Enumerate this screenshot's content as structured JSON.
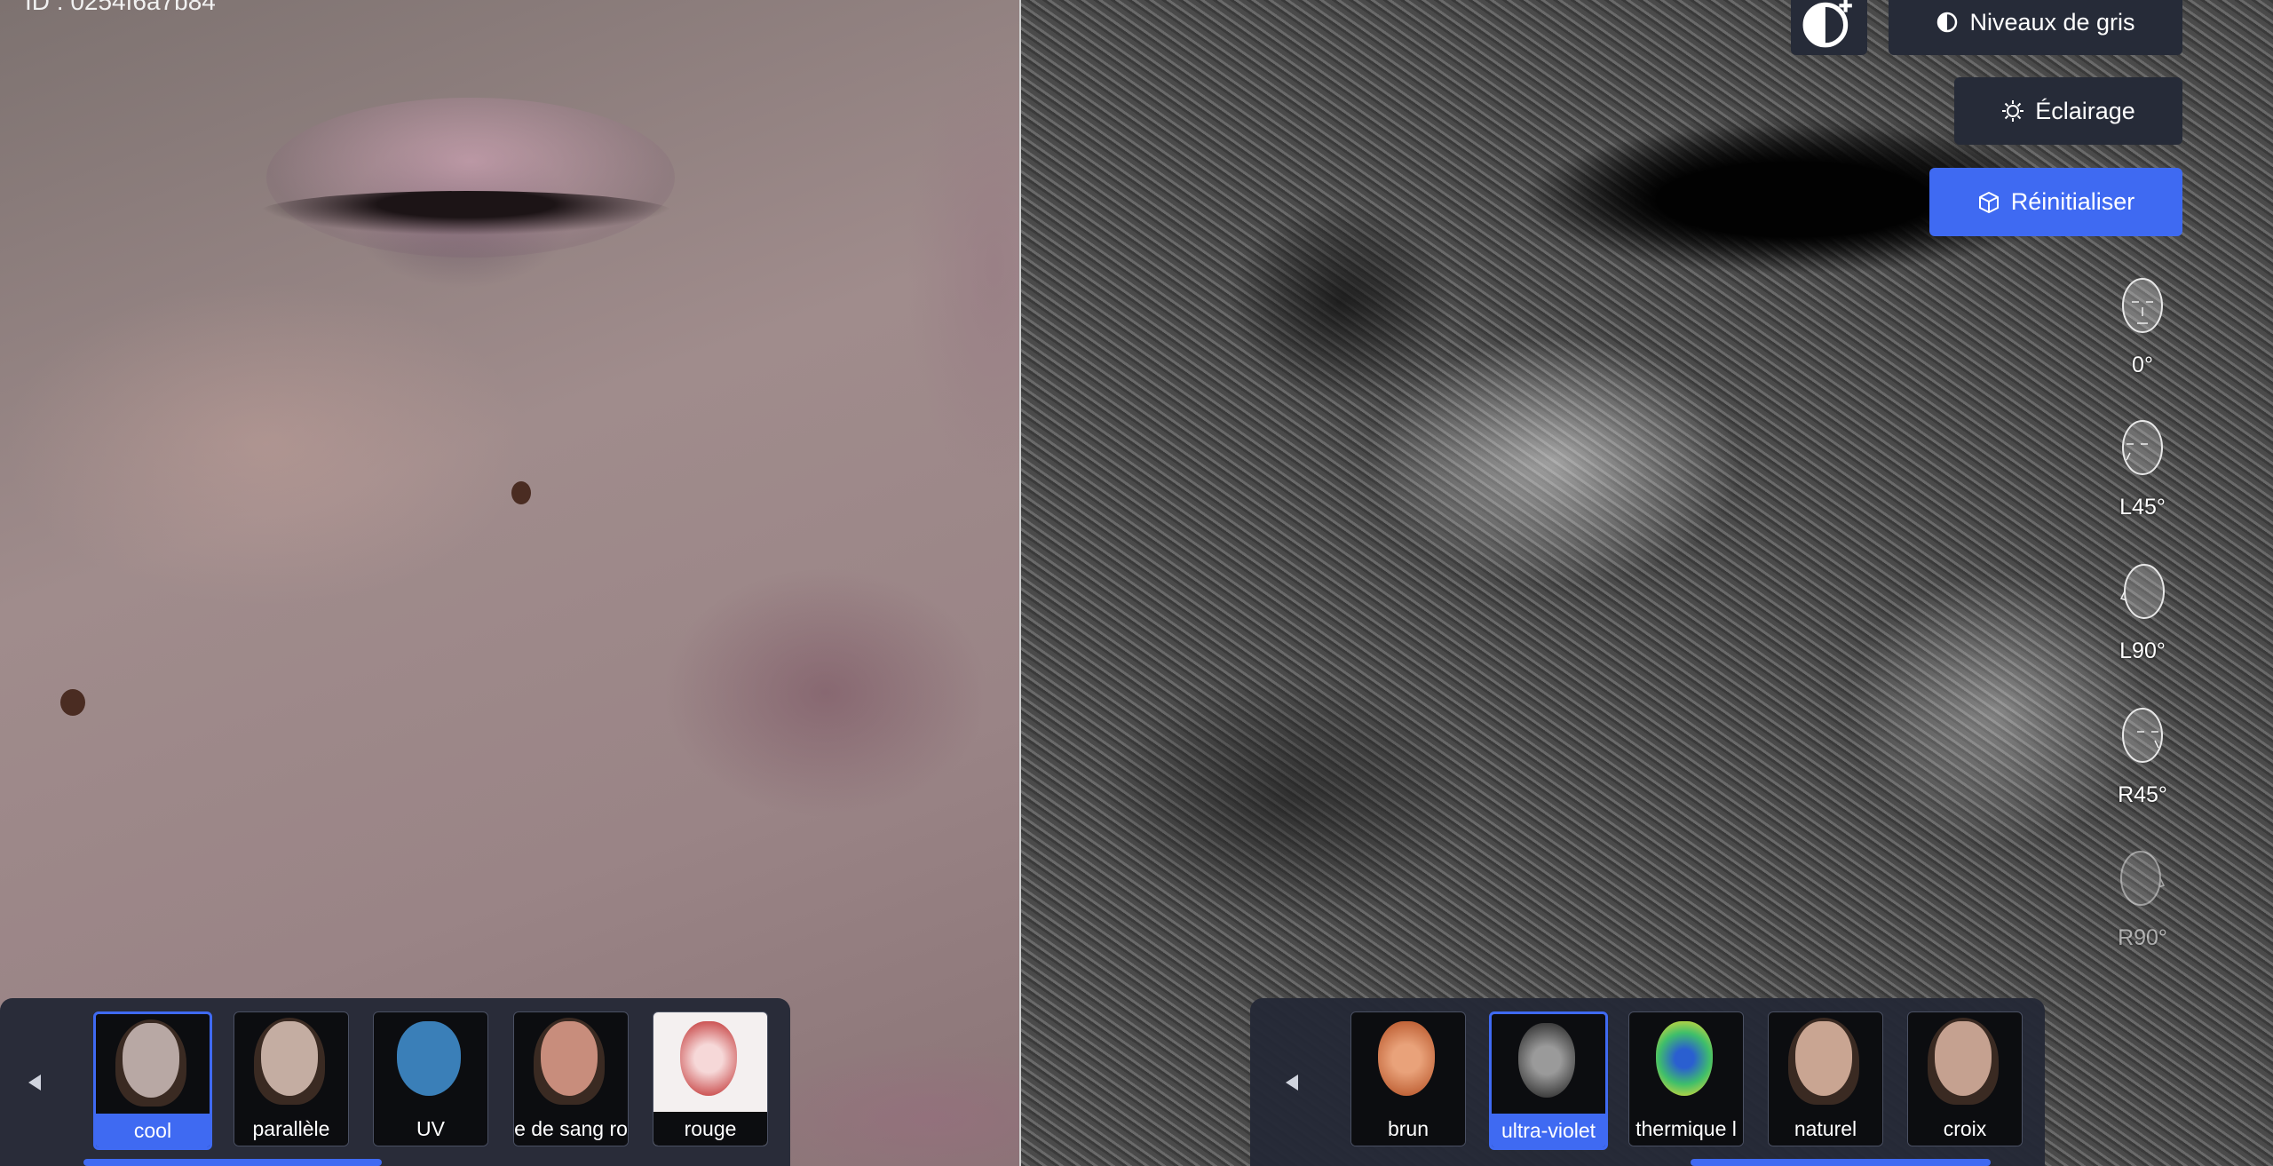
{
  "header": {
    "id_label": "ID : 0254f6a7b84"
  },
  "controls": {
    "contrast_add_icon": "contrast-plus-icon",
    "grayscale_label": "Niveaux de gris",
    "lighting_label": "Éclairage",
    "reset_label": "Réinitialiser",
    "accent_color": "#3f6af2",
    "button_color": "#262b38"
  },
  "angles": [
    {
      "label": "0°"
    },
    {
      "label": "L45°"
    },
    {
      "label": "L90°"
    },
    {
      "label": "R45°"
    },
    {
      "label": "R90°"
    }
  ],
  "left_filters": {
    "items": [
      {
        "label": "cool",
        "selected": true
      },
      {
        "label": "parallèle",
        "selected": false
      },
      {
        "label": "UV",
        "selected": false
      },
      {
        "label": "e de sang ro",
        "selected": false
      },
      {
        "label": "rouge",
        "selected": false
      }
    ]
  },
  "right_filters": {
    "items": [
      {
        "label": "brun",
        "selected": false
      },
      {
        "label": "ultra-violet",
        "selected": true
      },
      {
        "label": "thermique l",
        "selected": false
      },
      {
        "label": "naturel",
        "selected": false
      },
      {
        "label": "croix",
        "selected": false
      }
    ]
  }
}
